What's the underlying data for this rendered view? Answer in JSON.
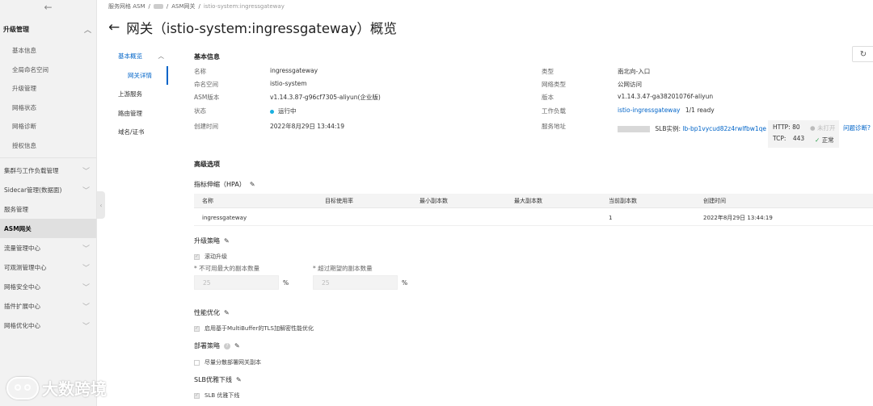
{
  "sidebar": {
    "section": "升级管理",
    "sub_items": [
      "基本信息",
      "全局命名空间",
      "升级管理",
      "网格状态",
      "网格诊断",
      "授权信息"
    ],
    "items": [
      {
        "label": "集群与工作负载管理",
        "chev": true
      },
      {
        "label": "Sidecar管理(数据面)",
        "chev": true
      },
      {
        "label": "服务管理",
        "chev": false
      },
      {
        "label": "ASM网关",
        "chev": false,
        "active": true
      },
      {
        "label": "流量管理中心",
        "chev": true
      },
      {
        "label": "可观测管理中心",
        "chev": true
      },
      {
        "label": "网格安全中心",
        "chev": true
      },
      {
        "label": "插件扩展中心",
        "chev": true
      },
      {
        "label": "网格优化中心",
        "chev": true
      }
    ]
  },
  "breadcrumb": {
    "root": "服务网格 ASM",
    "middle": "ASM网关",
    "current": "istio-system:ingressgateway"
  },
  "title": "网关（istio-system:ingressgateway）概览",
  "subnav": {
    "parent": "基本概览",
    "selected": "网关详情",
    "items": [
      "上游服务",
      "路由管理",
      "域名/证书"
    ]
  },
  "basic": {
    "heading": "基本信息",
    "left": [
      {
        "label": "名称",
        "value": "ingressgateway"
      },
      {
        "label": "命名空间",
        "value": "istio-system"
      },
      {
        "label": "ASM版本",
        "value": "v1.14.3.87-g96cf7305-aliyun(企业版)"
      },
      {
        "label": "状态",
        "value": "运行中"
      },
      {
        "label": "创建时间",
        "value": "2022年8月29日 13:44:19"
      }
    ],
    "right": [
      {
        "label": "类型",
        "value": "南北向-入口"
      },
      {
        "label": "网络类型",
        "value": "公网访问"
      },
      {
        "label": "版本",
        "value": "v1.14.3.47-ga38201076f-aliyun"
      },
      {
        "label": "工作负载",
        "value": "istio-ingressgateway",
        "suffix": "1/1 ready"
      },
      {
        "label": "服务地址"
      }
    ],
    "slb_prefix": "SLB实例:",
    "slb_id": "lb-bp1vycud82z4rwlfbw1qe",
    "http_label": "HTTP:",
    "http_port": "80",
    "http_status": "未打开",
    "tcp_label": "TCP:",
    "tcp_port": "443",
    "tcp_status": "正常",
    "diag_link": "问题诊断?"
  },
  "advanced": {
    "heading": "高级选项",
    "hpa": {
      "title": "指标伸缩（HPA）",
      "columns": [
        "名称",
        "目标使用率",
        "最小副本数",
        "最大副本数",
        "当前副本数",
        "创建时间"
      ],
      "rows": [
        [
          "ingressgateway",
          "",
          "",
          "",
          "1",
          "2022年8月29日 13:44:19"
        ]
      ]
    },
    "upgrade": {
      "title": "升级策略",
      "rolling": "滚动升级",
      "max_unavailable_label": "* 不可用最大的副本数量",
      "max_surge_label": "* 超过期望的副本数量",
      "max_unavailable_value": "25",
      "max_surge_value": "25",
      "unit": "%"
    },
    "perf": {
      "title": "性能优化",
      "option": "启用基于MultiBuffer的TLS加解密性能优化"
    },
    "deploy": {
      "title": "部署策略",
      "option": "尽量分散部署网关副本"
    },
    "slb": {
      "title": "SLB优雅下线",
      "option": "SLB 优雅下线"
    }
  },
  "watermark": "大数跨境"
}
